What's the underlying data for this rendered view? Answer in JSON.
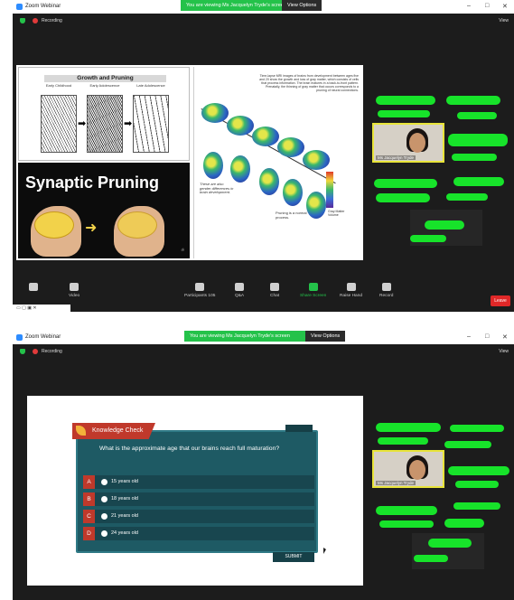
{
  "screenshot1": {
    "window_title": "Zoom Webinar",
    "banner_text": "You are viewing Ms Jacquelyn Tryde's screen",
    "view_options": "View Options",
    "recording": "Recording",
    "view_label": "View",
    "slide_left": {
      "title": "Growth and Pruning",
      "stages": [
        "Early Childhood",
        "Early Adolescence",
        "Late Adolescence"
      ],
      "pruning_title": "Synaptic Pruning"
    },
    "slide_right": {
      "intro": "Time-lapse MRI images of brains from development between ages five and 20 show the growth and loss of gray matter, which consists of cells that process information. The brain matures in a back-to-front pattern. Prenatally, the thinning of gray matter that occurs corresponds to a pruning of neural connections.",
      "side_text": "These are also gender differences in brain development.",
      "bottom_text": "Pruning is a normal process.",
      "scale_label": "Gray Matter Volume"
    },
    "speaker_name": "Ms Jacquelyn Tryde",
    "toolbar": [
      {
        "label": "Participants",
        "count": "105"
      },
      {
        "label": "Q&A"
      },
      {
        "label": "Chat"
      },
      {
        "label": "Share Screen"
      },
      {
        "label": "Raise Hand"
      },
      {
        "label": "Record"
      }
    ],
    "mute_label": "",
    "video_label": "Video",
    "leave_label": "Leave"
  },
  "screenshot2": {
    "window_title": "Zoom Webinar",
    "banner_text": "You are viewing Ms Jacquelyn Tryde's screen",
    "view_options": "View Options",
    "recording": "Recording",
    "view_label": "View",
    "quiz": {
      "header": "Knowledge Check",
      "question": "What is the approximate age that our brains reach full maturation?",
      "options": [
        {
          "letter": "A",
          "text": "15 years old"
        },
        {
          "letter": "B",
          "text": "18 years old"
        },
        {
          "letter": "C",
          "text": "21 years old"
        },
        {
          "letter": "D",
          "text": "24 years old"
        }
      ],
      "submit": "SUBMIT"
    },
    "speaker_name": "Ms Jacquelyn Tryde"
  },
  "colors": {
    "banner_green": "#24c24a",
    "redaction_green": "#17e32a",
    "leave_red": "#e02828",
    "quiz_teal": "#1e5a64",
    "quiz_red": "#c0392b",
    "speaker_highlight": "#e8e43a"
  },
  "icons": [
    "zoom-logo-icon",
    "shield-icon",
    "record-dot-icon",
    "participants-icon",
    "qa-icon",
    "chat-icon",
    "share-screen-icon",
    "raise-hand-icon",
    "record-icon",
    "mic-icon",
    "video-icon",
    "leaf-icon"
  ]
}
